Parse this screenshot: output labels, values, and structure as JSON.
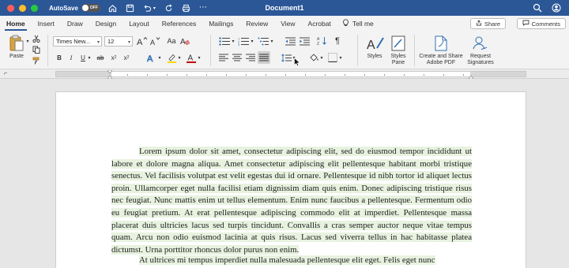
{
  "titlebar": {
    "autosave_label": "AutoSave",
    "autosave_state": "OFF",
    "doc_title": "Document1"
  },
  "tabs": [
    {
      "label": "Home",
      "active": true
    },
    {
      "label": "Insert"
    },
    {
      "label": "Draw"
    },
    {
      "label": "Design"
    },
    {
      "label": "Layout"
    },
    {
      "label": "References"
    },
    {
      "label": "Mailings"
    },
    {
      "label": "Review"
    },
    {
      "label": "View"
    },
    {
      "label": "Acrobat"
    }
  ],
  "tellme": "Tell me",
  "share_label": "Share",
  "comments_label": "Comments",
  "ribbon": {
    "paste_label": "Paste",
    "font_name": "Times New...",
    "font_size": "12",
    "styles_label": "Styles",
    "styles_pane_label": [
      "Styles",
      "Pane"
    ],
    "create_share_label": [
      "Create and Share",
      "Adobe PDF"
    ],
    "request_sig_label": [
      "Request",
      "Signatures"
    ],
    "colors": {
      "highlight": "#ffd700",
      "font_color": "#c00000"
    }
  },
  "document": {
    "para1": "Lorem ipsum dolor sit amet, consectetur adipiscing elit, sed do eiusmod tempor incididunt ut labore et dolore magna aliqua. Amet consectetur adipiscing elit pellentesque habitant morbi tristique senectus. Vel facilisis volutpat est velit egestas dui id ornare. Pellentesque id nibh tortor id aliquet lectus proin. Ullamcorper eget nulla facilisi etiam dignissim diam quis enim. Donec adipiscing tristique risus nec feugiat. Nunc mattis enim ut tellus elementum. Enim nunc faucibus a pellentesque. Fermentum odio eu feugiat pretium. At erat pellentesque adipiscing commodo elit at imperdiet. Pellentesque massa placerat duis ultricies lacus sed turpis tincidunt. Convallis a cras semper auctor neque vitae tempus quam. Arcu non odio euismod lacinia at quis risus. Lacus sed viverra tellus in hac habitasse platea dictumst. Urna porttitor rhoncus dolor purus non enim.",
    "para2": "At ultrices mi tempus imperdiet nulla malesuada pellentesque elit eget. Felis eget nunc"
  }
}
